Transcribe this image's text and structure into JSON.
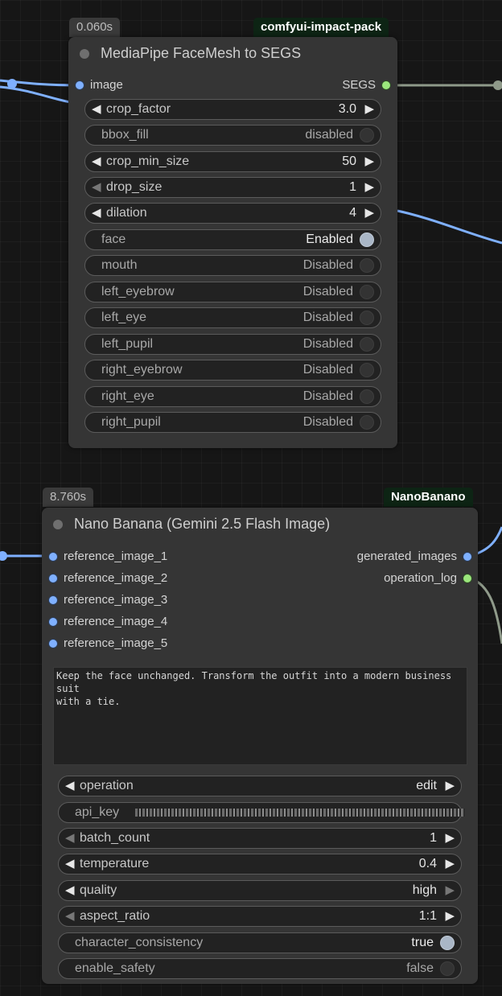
{
  "node1": {
    "time": "0.060s",
    "pack": "comfyui-impact-pack",
    "title": "MediaPipe FaceMesh to SEGS",
    "input": "image",
    "output": "SEGS",
    "widgets": [
      {
        "label": "crop_factor",
        "value": "3.0"
      },
      {
        "label": "bbox_fill",
        "value": "disabled"
      },
      {
        "label": "crop_min_size",
        "value": "50"
      },
      {
        "label": "drop_size",
        "value": "1"
      },
      {
        "label": "dilation",
        "value": "4"
      },
      {
        "label": "face",
        "value": "Enabled"
      },
      {
        "label": "mouth",
        "value": "Disabled"
      },
      {
        "label": "left_eyebrow",
        "value": "Disabled"
      },
      {
        "label": "left_eye",
        "value": "Disabled"
      },
      {
        "label": "left_pupil",
        "value": "Disabled"
      },
      {
        "label": "right_eyebrow",
        "value": "Disabled"
      },
      {
        "label": "right_eye",
        "value": "Disabled"
      },
      {
        "label": "right_pupil",
        "value": "Disabled"
      }
    ]
  },
  "node2": {
    "time": "8.760s",
    "pack": "NanoBanano",
    "title": "Nano Banana (Gemini 2.5 Flash Image)",
    "inputs": [
      "reference_image_1",
      "reference_image_2",
      "reference_image_3",
      "reference_image_4",
      "reference_image_5"
    ],
    "outputs": [
      "generated_images",
      "operation_log"
    ],
    "prompt": "Keep the face unchanged. Transform the outfit into a modern business suit\nwith a tie.",
    "widgets": [
      {
        "label": "operation",
        "value": "edit"
      },
      {
        "label": "api_key",
        "value": ""
      },
      {
        "label": "batch_count",
        "value": "1"
      },
      {
        "label": "temperature",
        "value": "0.4"
      },
      {
        "label": "quality",
        "value": "high"
      },
      {
        "label": "aspect_ratio",
        "value": "1:1"
      },
      {
        "label": "character_consistency",
        "value": "true"
      },
      {
        "label": "enable_safety",
        "value": "false"
      }
    ]
  },
  "colors": {
    "background": "#161616",
    "node": "#353535",
    "wire_image": "#7fb0ff",
    "wire_segs": "#8f9a8a",
    "pin_green": "#9be67c",
    "pack_tag": "#0d2414"
  }
}
